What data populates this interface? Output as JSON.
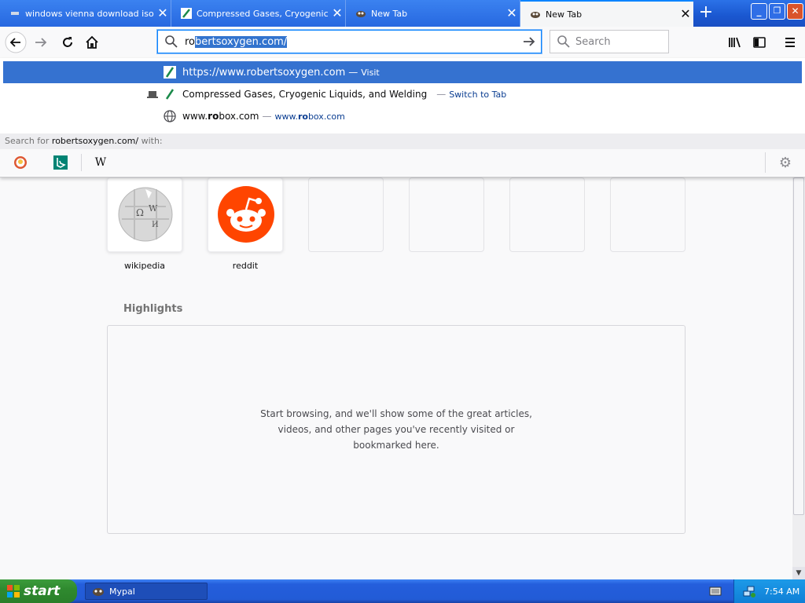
{
  "tabs": [
    {
      "title": "windows vienna download iso at o",
      "active": false,
      "icon": "generic-favicon-icon"
    },
    {
      "title": "Compressed Gases, Cryogenic Liq",
      "active": false,
      "icon": "robertsoxygen-favicon-icon"
    },
    {
      "title": "New Tab",
      "active": false,
      "icon": "mypal-icon"
    },
    {
      "title": "New Tab",
      "active": true,
      "icon": "mypal-icon"
    }
  ],
  "urlbar": {
    "typed": "ro",
    "selected": "bertsoxygen.com/"
  },
  "searchbox": {
    "placeholder": "Search"
  },
  "autocomplete": {
    "rows": [
      {
        "text": "https://www.robertsoxygen.com",
        "action": "Visit"
      },
      {
        "text": "Compressed Gases, Cryogenic Liquids, and Welding",
        "action": "Switch to Tab"
      },
      {
        "text_pre": "www.",
        "text_bold": "ro",
        "text_post": "box.com",
        "url_pre": "www.",
        "url_bold": "ro",
        "url_post": "box.com"
      }
    ],
    "search_for_prefix": "Search for",
    "search_for_query": "robertsoxygen.com/",
    "search_for_suffix": "with:",
    "engines": [
      "DuckDuckGo",
      "Bing",
      "Wikipedia"
    ]
  },
  "topsites": [
    {
      "label": "wikipedia"
    },
    {
      "label": "reddit"
    }
  ],
  "highlights": {
    "title": "Highlights",
    "message": "Start browsing, and we'll show some of the great articles, videos, and other pages you've recently visited or bookmarked here."
  },
  "taskbar": {
    "start_label": "start",
    "window_label": "Mypal",
    "clock": "7:54 AM"
  },
  "colors": {
    "selection": "#3572d0",
    "accent": "#0a84ff",
    "reddit": "#ff4500"
  }
}
